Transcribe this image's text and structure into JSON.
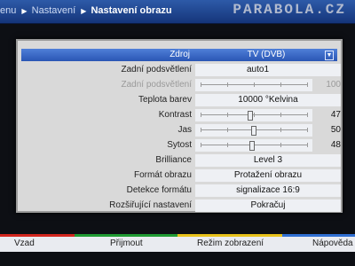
{
  "breadcrumb": {
    "items": [
      "enu",
      "Nastavení",
      "Nastavení obrazu"
    ]
  },
  "watermark": "PARABOLA.CZ",
  "panel": {
    "rows": [
      {
        "label": "Zdroj",
        "value": "TV (DVB)",
        "selected": true
      },
      {
        "label": "Zadní podsvětlení",
        "value": "auto1"
      },
      {
        "label": "Zadní podsvětlení",
        "value": "100",
        "slider": 1.0,
        "disabled": true
      },
      {
        "label": "Teplota barev",
        "value": "10000 °Kelvina"
      },
      {
        "label": "Kontrast",
        "value": "47",
        "slider": 0.47
      },
      {
        "label": "Jas",
        "value": "50",
        "slider": 0.5
      },
      {
        "label": "Sytost",
        "value": "48",
        "slider": 0.48
      },
      {
        "label": "Brilliance",
        "value": "Level 3"
      },
      {
        "label": "Formát obrazu",
        "value": "Protažení obrazu"
      },
      {
        "label": "Detekce formátu",
        "value": "signalizace 16:9"
      },
      {
        "label": "Rozšiřující nastavení",
        "value": "Pokračuj"
      }
    ]
  },
  "buttons": [
    {
      "label": "Vzad",
      "color": "#d2261e"
    },
    {
      "label": "Přijmout",
      "color": "#1f9a33"
    },
    {
      "label": "Režim zobrazení",
      "color": "#e8c21a"
    },
    {
      "label": "Nápověda",
      "color": "#2f6fd2"
    }
  ],
  "colors": {
    "selection": "#3b6ac8",
    "header": "#1d4592"
  }
}
